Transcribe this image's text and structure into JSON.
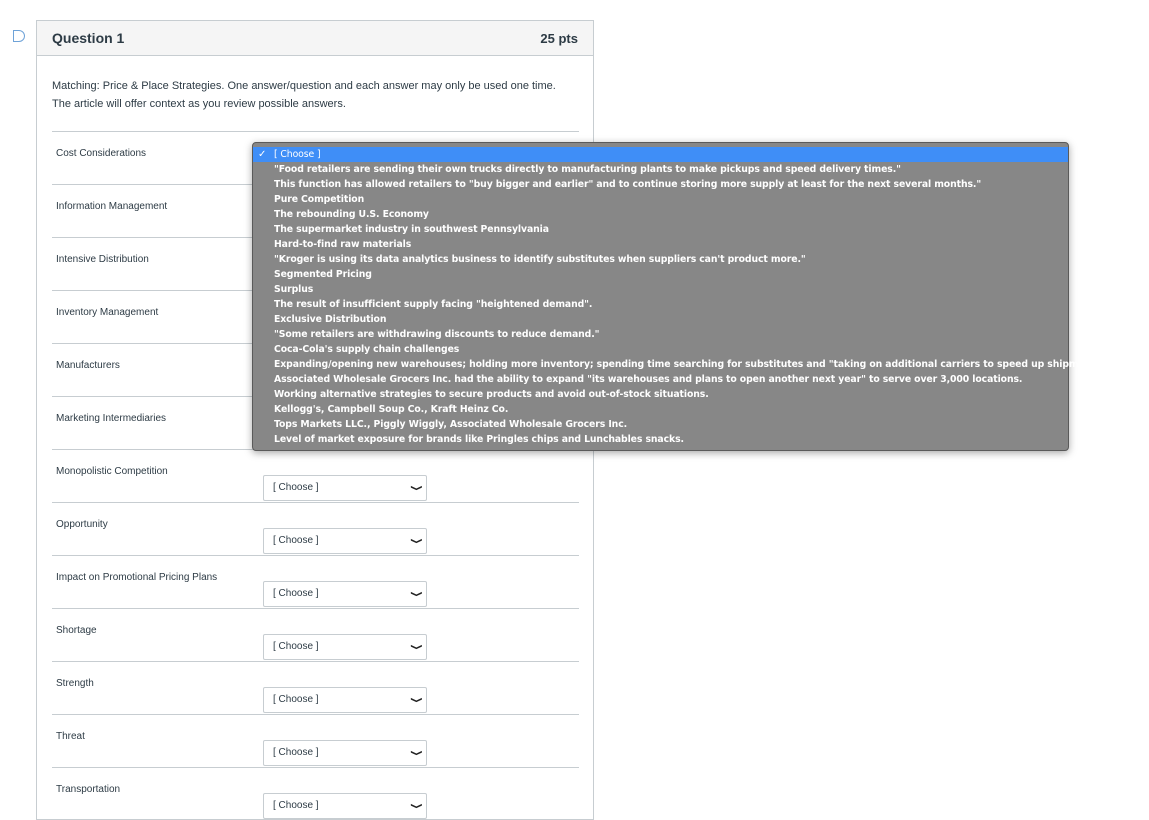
{
  "question": {
    "title": "Question 1",
    "points": "25 pts",
    "text": "Matching:  Price & Place Strategies.  One answer/question and each answer may only be used one time.  The article will offer context as you review possible answers."
  },
  "rows": [
    {
      "label": "Cost Considerations",
      "value": "[ Choose ]"
    },
    {
      "label": "Information Management",
      "value": "[ Choose ]"
    },
    {
      "label": "Intensive Distribution",
      "value": "[ Choose ]"
    },
    {
      "label": "Inventory Management",
      "value": "[ Choose ]"
    },
    {
      "label": "Manufacturers",
      "value": "[ Choose ]"
    },
    {
      "label": "Marketing Intermediaries",
      "value": "[ Choose ]"
    },
    {
      "label": "Monopolistic Competition",
      "value": "[ Choose ]"
    },
    {
      "label": "Opportunity",
      "value": "[ Choose ]"
    },
    {
      "label": "Impact on Promotional Pricing Plans",
      "value": "[ Choose ]"
    },
    {
      "label": "Shortage",
      "value": "[ Choose ]"
    },
    {
      "label": "Strength",
      "value": "[ Choose ]"
    },
    {
      "label": "Threat",
      "value": "[ Choose ]"
    },
    {
      "label": "Transportation",
      "value": "[ Choose ]"
    }
  ],
  "dropdown": {
    "selected_index": 0,
    "options": [
      "[ Choose ]",
      "\"Food retailers are sending their own trucks directly to manufacturing plants to make pickups and speed delivery times.\"",
      "This function has allowed retailers to \"buy bigger and earlier\" and to continue storing more supply at least for the next several months.\"",
      "Pure Competition",
      "The rebounding U.S. Economy",
      "The supermarket industry in southwest Pennsylvania",
      "Hard-to-find raw materials",
      "\"Kroger is using its data analytics business to identify substitutes when suppliers can't product more.\"",
      "Segmented Pricing",
      "Surplus",
      "The result of insufficient supply facing \"heightened demand\".",
      "Exclusive Distribution",
      "\"Some retailers are withdrawing discounts to reduce demand.\"",
      "Coca-Cola's supply chain challenges",
      "Expanding/opening new warehouses; holding more inventory; spending time searching for substitutes and \"taking on additional carriers to speed up shipments\".",
      "Associated Wholesale Grocers Inc. had the ability to expand \"its warehouses and plans to open another next year\" to serve over 3,000 locations.",
      "Working alternative strategies to secure products and avoid out-of-stock situations.",
      "Kellogg's, Campbell Soup Co., Kraft Heinz Co.",
      "Tops Markets LLC., Piggly Wiggly, Associated Wholesale Grocers Inc.",
      "Level of market exposure for brands like Pringles chips and Lunchables snacks."
    ]
  },
  "colors": {
    "highlight": "#3f8ef7",
    "popup_bg": "#878787",
    "header_bg": "#f5f5f5"
  }
}
